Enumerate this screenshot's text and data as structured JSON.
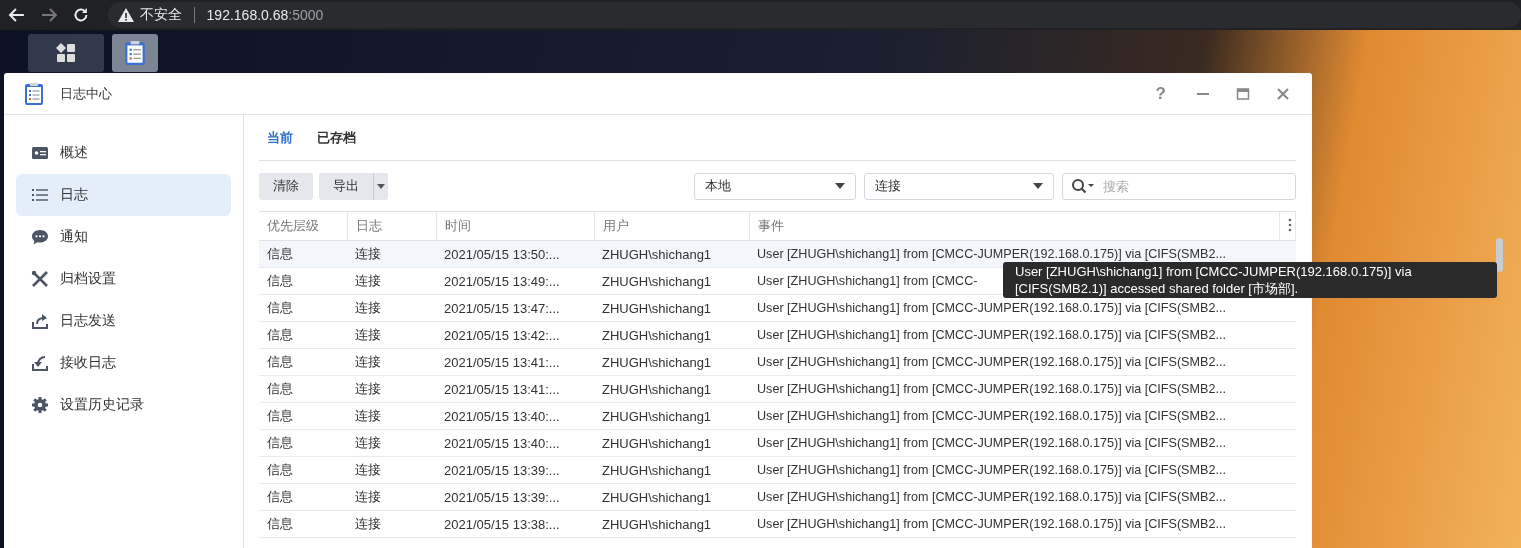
{
  "browser": {
    "warning": "不安全",
    "host": "192.168.0.68",
    "port": ":5000"
  },
  "taskbar": [
    {
      "kind": "apps",
      "selected": false
    },
    {
      "kind": "log-center",
      "selected": true
    }
  ],
  "window": {
    "title": "日志中心",
    "help": "?"
  },
  "sidebar": {
    "items": [
      {
        "kind": "overview",
        "label": "概述",
        "selected": false
      },
      {
        "kind": "logs",
        "label": "日志",
        "selected": true
      },
      {
        "kind": "notify",
        "label": "通知",
        "selected": false
      },
      {
        "kind": "archive",
        "label": "归档设置",
        "selected": false
      },
      {
        "kind": "send",
        "label": "日志发送",
        "selected": false
      },
      {
        "kind": "receive",
        "label": "接收日志",
        "selected": false
      },
      {
        "kind": "history",
        "label": "设置历史记录",
        "selected": false
      }
    ]
  },
  "tabs": [
    {
      "label": "当前",
      "selected": true
    },
    {
      "label": "已存档",
      "selected": false
    }
  ],
  "toolbar": {
    "clear": "清除",
    "export": "导出",
    "source": "本地",
    "category": "连接",
    "search": {
      "placeholder": "搜索"
    }
  },
  "table": {
    "columns": [
      "优先层级",
      "日志",
      "时间",
      "用户",
      "事件"
    ],
    "rows": [
      {
        "priority": "信息",
        "log": "连接",
        "time": "2021/05/15 13:50:...",
        "user": "ZHUGH\\shichang1",
        "event": "User [ZHUGH\\shichang1] from [CMCC-JUMPER(192.168.0.175)] via [CIFS(SMB2...",
        "selected": true
      },
      {
        "priority": "信息",
        "log": "连接",
        "time": "2021/05/15 13:49:...",
        "user": "ZHUGH\\shichang1",
        "event": "User [ZHUGH\\shichang1] from [CMCC-",
        "selected": false
      },
      {
        "priority": "信息",
        "log": "连接",
        "time": "2021/05/15 13:47:...",
        "user": "ZHUGH\\shichang1",
        "event": "User [ZHUGH\\shichang1] from [CMCC-JUMPER(192.168.0.175)] via [CIFS(SMB2...",
        "selected": false
      },
      {
        "priority": "信息",
        "log": "连接",
        "time": "2021/05/15 13:42:...",
        "user": "ZHUGH\\shichang1",
        "event": "User [ZHUGH\\shichang1] from [CMCC-JUMPER(192.168.0.175)] via [CIFS(SMB2...",
        "selected": false
      },
      {
        "priority": "信息",
        "log": "连接",
        "time": "2021/05/15 13:41:...",
        "user": "ZHUGH\\shichang1",
        "event": "User [ZHUGH\\shichang1] from [CMCC-JUMPER(192.168.0.175)] via [CIFS(SMB2...",
        "selected": false
      },
      {
        "priority": "信息",
        "log": "连接",
        "time": "2021/05/15 13:41:...",
        "user": "ZHUGH\\shichang1",
        "event": "User [ZHUGH\\shichang1] from [CMCC-JUMPER(192.168.0.175)] via [CIFS(SMB2...",
        "selected": false
      },
      {
        "priority": "信息",
        "log": "连接",
        "time": "2021/05/15 13:40:...",
        "user": "ZHUGH\\shichang1",
        "event": "User [ZHUGH\\shichang1] from [CMCC-JUMPER(192.168.0.175)] via [CIFS(SMB2...",
        "selected": false
      },
      {
        "priority": "信息",
        "log": "连接",
        "time": "2021/05/15 13:40:...",
        "user": "ZHUGH\\shichang1",
        "event": "User [ZHUGH\\shichang1] from [CMCC-JUMPER(192.168.0.175)] via [CIFS(SMB2...",
        "selected": false
      },
      {
        "priority": "信息",
        "log": "连接",
        "time": "2021/05/15 13:39:...",
        "user": "ZHUGH\\shichang1",
        "event": "User [ZHUGH\\shichang1] from [CMCC-JUMPER(192.168.0.175)] via [CIFS(SMB2...",
        "selected": false
      },
      {
        "priority": "信息",
        "log": "连接",
        "time": "2021/05/15 13:39:...",
        "user": "ZHUGH\\shichang1",
        "event": "User [ZHUGH\\shichang1] from [CMCC-JUMPER(192.168.0.175)] via [CIFS(SMB2...",
        "selected": false
      },
      {
        "priority": "信息",
        "log": "连接",
        "time": "2021/05/15 13:38:...",
        "user": "ZHUGH\\shichang1",
        "event": "User [ZHUGH\\shichang1] from [CMCC-JUMPER(192.168.0.175)] via [CIFS(SMB2...",
        "selected": false
      }
    ]
  },
  "tooltip": "User [ZHUGH\\shichang1] from [CMCC-JUMPER(192.168.0.175)] via [CIFS(SMB2.1)] accessed shared folder [市场部]."
}
